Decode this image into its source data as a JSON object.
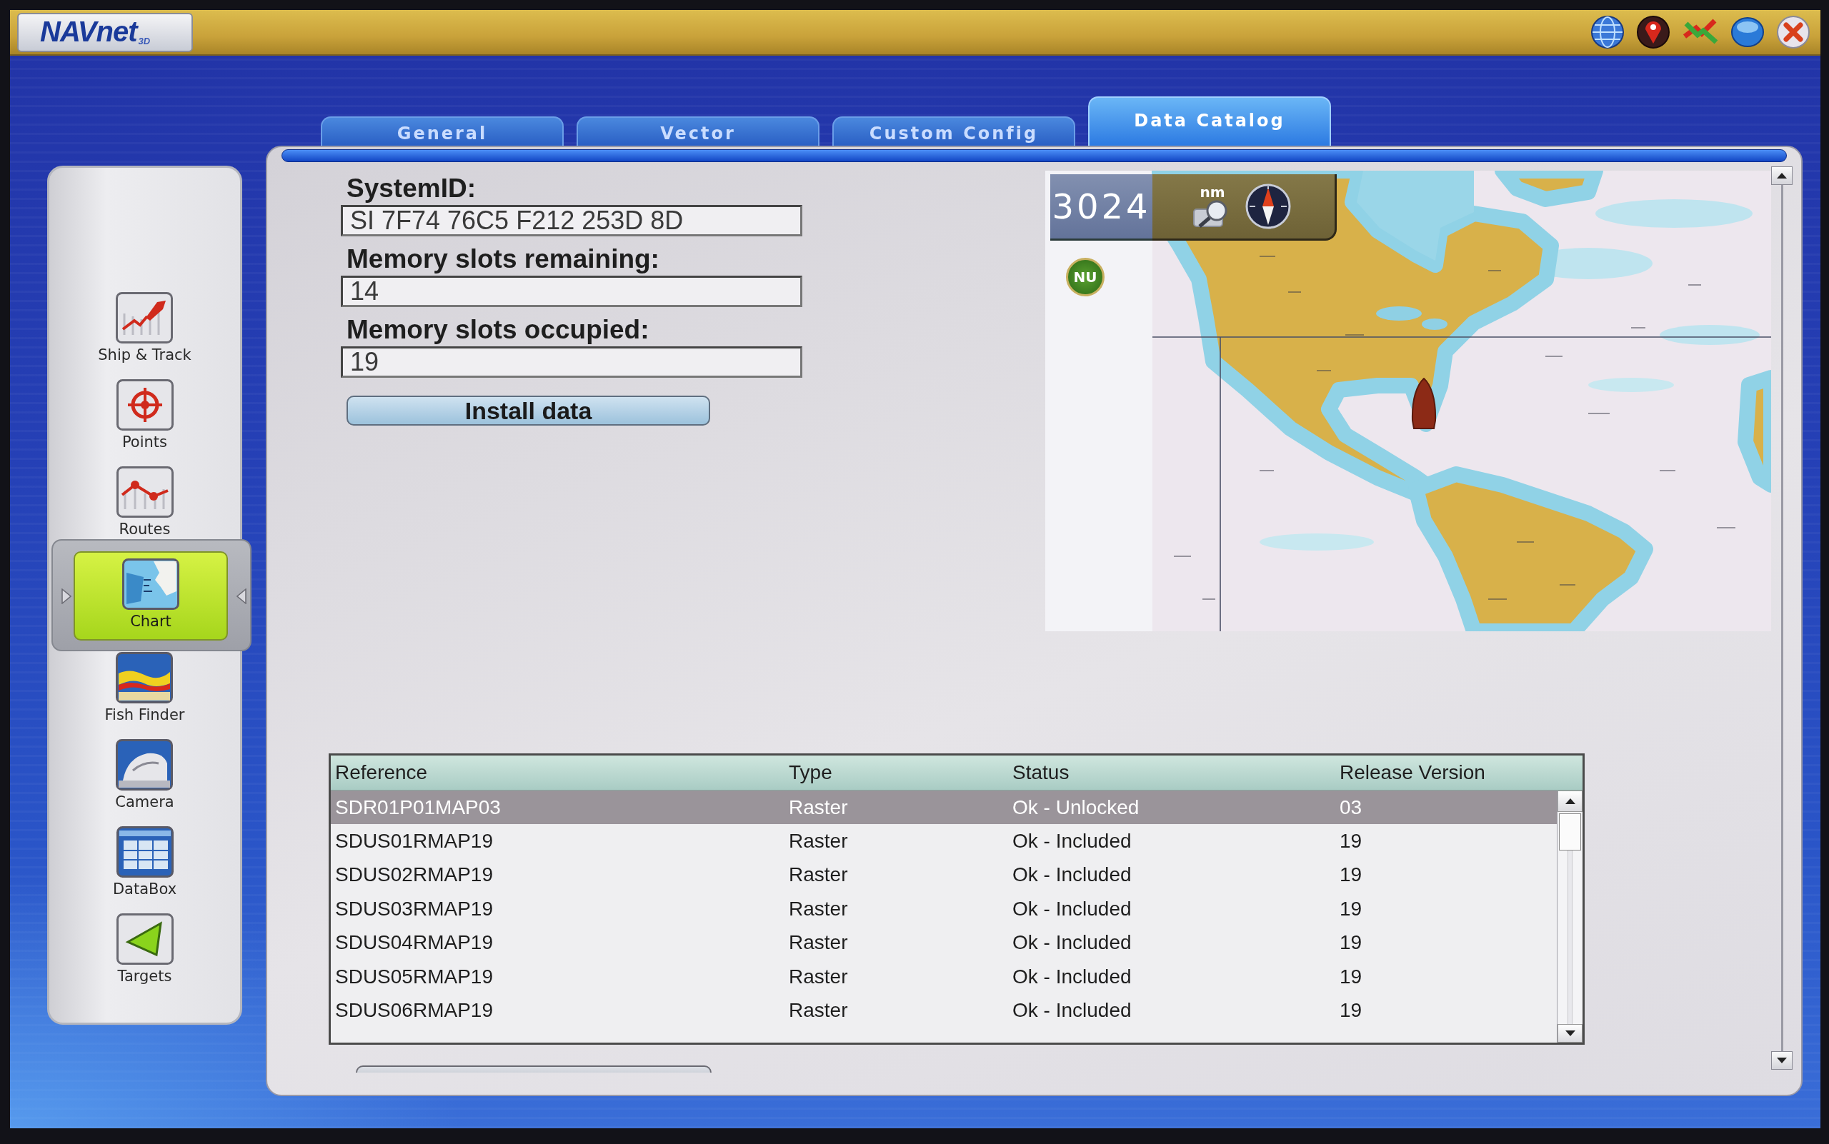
{
  "header": {
    "logo": "NAVnet",
    "logo_badge": "3D"
  },
  "tabs": [
    {
      "label": "General",
      "selected": false
    },
    {
      "label": "Vector",
      "selected": false
    },
    {
      "label": "Custom Config",
      "selected": false
    },
    {
      "label": "Data Catalog",
      "selected": true
    }
  ],
  "sidebar": {
    "items": [
      {
        "label": "Ship & Track",
        "selected": false
      },
      {
        "label": "Points",
        "selected": false
      },
      {
        "label": "Routes",
        "selected": false
      },
      {
        "label": "Chart",
        "selected": true
      },
      {
        "label": "Fish Finder",
        "selected": false
      },
      {
        "label": "Camera",
        "selected": false
      },
      {
        "label": "DataBox",
        "selected": false
      },
      {
        "label": "Targets",
        "selected": false
      }
    ]
  },
  "system_info": {
    "fields": [
      {
        "label": "SystemID:",
        "value": "SI 7F74 76C5 F212 253D 8D"
      },
      {
        "label": "Memory slots remaining:",
        "value": "14"
      },
      {
        "label": "Memory slots occupied:",
        "value": "19"
      }
    ],
    "install_button": "Install data"
  },
  "chart_preview": {
    "scale": "3024",
    "unit": "nm",
    "orientation": "NU"
  },
  "catalog_table": {
    "columns": [
      "Reference",
      "Type",
      "Status",
      "Release Version"
    ],
    "rows": [
      {
        "selected": true,
        "cells": [
          "SDR01P01MAP03",
          "Raster",
          "Ok - Unlocked",
          "03"
        ]
      },
      {
        "selected": false,
        "cells": [
          "SDUS01RMAP19",
          "Raster",
          "Ok - Included",
          "19"
        ]
      },
      {
        "selected": false,
        "cells": [
          "SDUS02RMAP19",
          "Raster",
          "Ok - Included",
          "19"
        ]
      },
      {
        "selected": false,
        "cells": [
          "SDUS03RMAP19",
          "Raster",
          "Ok - Included",
          "19"
        ]
      },
      {
        "selected": false,
        "cells": [
          "SDUS04RMAP19",
          "Raster",
          "Ok - Included",
          "19"
        ]
      },
      {
        "selected": false,
        "cells": [
          "SDUS05RMAP19",
          "Raster",
          "Ok - Included",
          "19"
        ]
      },
      {
        "selected": false,
        "cells": [
          "SDUS06RMAP19",
          "Raster",
          "Ok - Included",
          "19"
        ]
      }
    ]
  }
}
